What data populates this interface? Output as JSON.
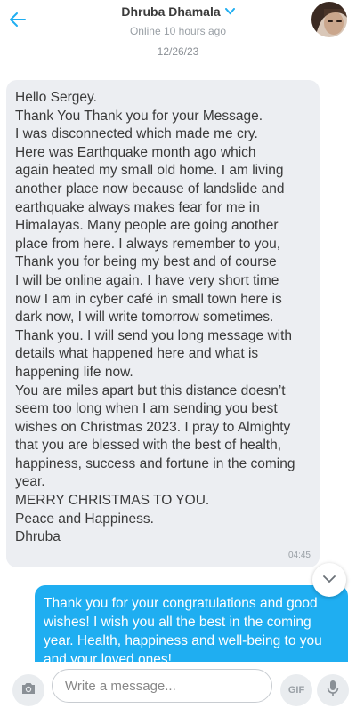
{
  "header": {
    "contact_name": "Dhruba Dhamala",
    "presence": "Online 10 hours ago",
    "verified_icon": "chevron-down-icon",
    "back_icon": "back-arrow-icon"
  },
  "conversation": {
    "date": "12/26/23",
    "incoming": {
      "text": "Hello Sergey.\nThank You Thank you for your Message.\nI was disconnected which made me cry.\nHere was Earthquake month ago which\nagain heated my small old home. I am living\nanother place now because of landslide and\nearthquake always makes fear for me in\nHimalayas. Many people are going another\nplace from here. I always remember to you,\nThank you for being my best and of course\nI will be online again. I have very short time\nnow I am in cyber café in small town here is\ndark now, I will write tomorrow sometimes.\nThank you. I will send you long message with\ndetails what happened here and what is\nhappening life now.\nYou are miles apart but this distance doesn’t\nseem too long when I am sending you best\nwishes on Christmas 2023. I pray to Almighty\nthat you are blessed with the best of health,\nhappiness, success and fortune in the coming\nyear.\nMERRY CHRISTMAS TO YOU.\nPeace and Happiness.\nDhruba",
      "time": "04:45"
    },
    "outgoing": {
      "text": "Thank you for your congratulations and good wishes! I wish you all the best in the coming year. Health, happiness and well-being to you and your loved ones!"
    }
  },
  "composer": {
    "placeholder": "Write a message...",
    "gif_label": "GIF",
    "camera_icon": "camera-icon",
    "mic_icon": "microphone-icon"
  },
  "colors": {
    "accent": "#1faef1",
    "incoming_bubble": "#eceef2"
  }
}
